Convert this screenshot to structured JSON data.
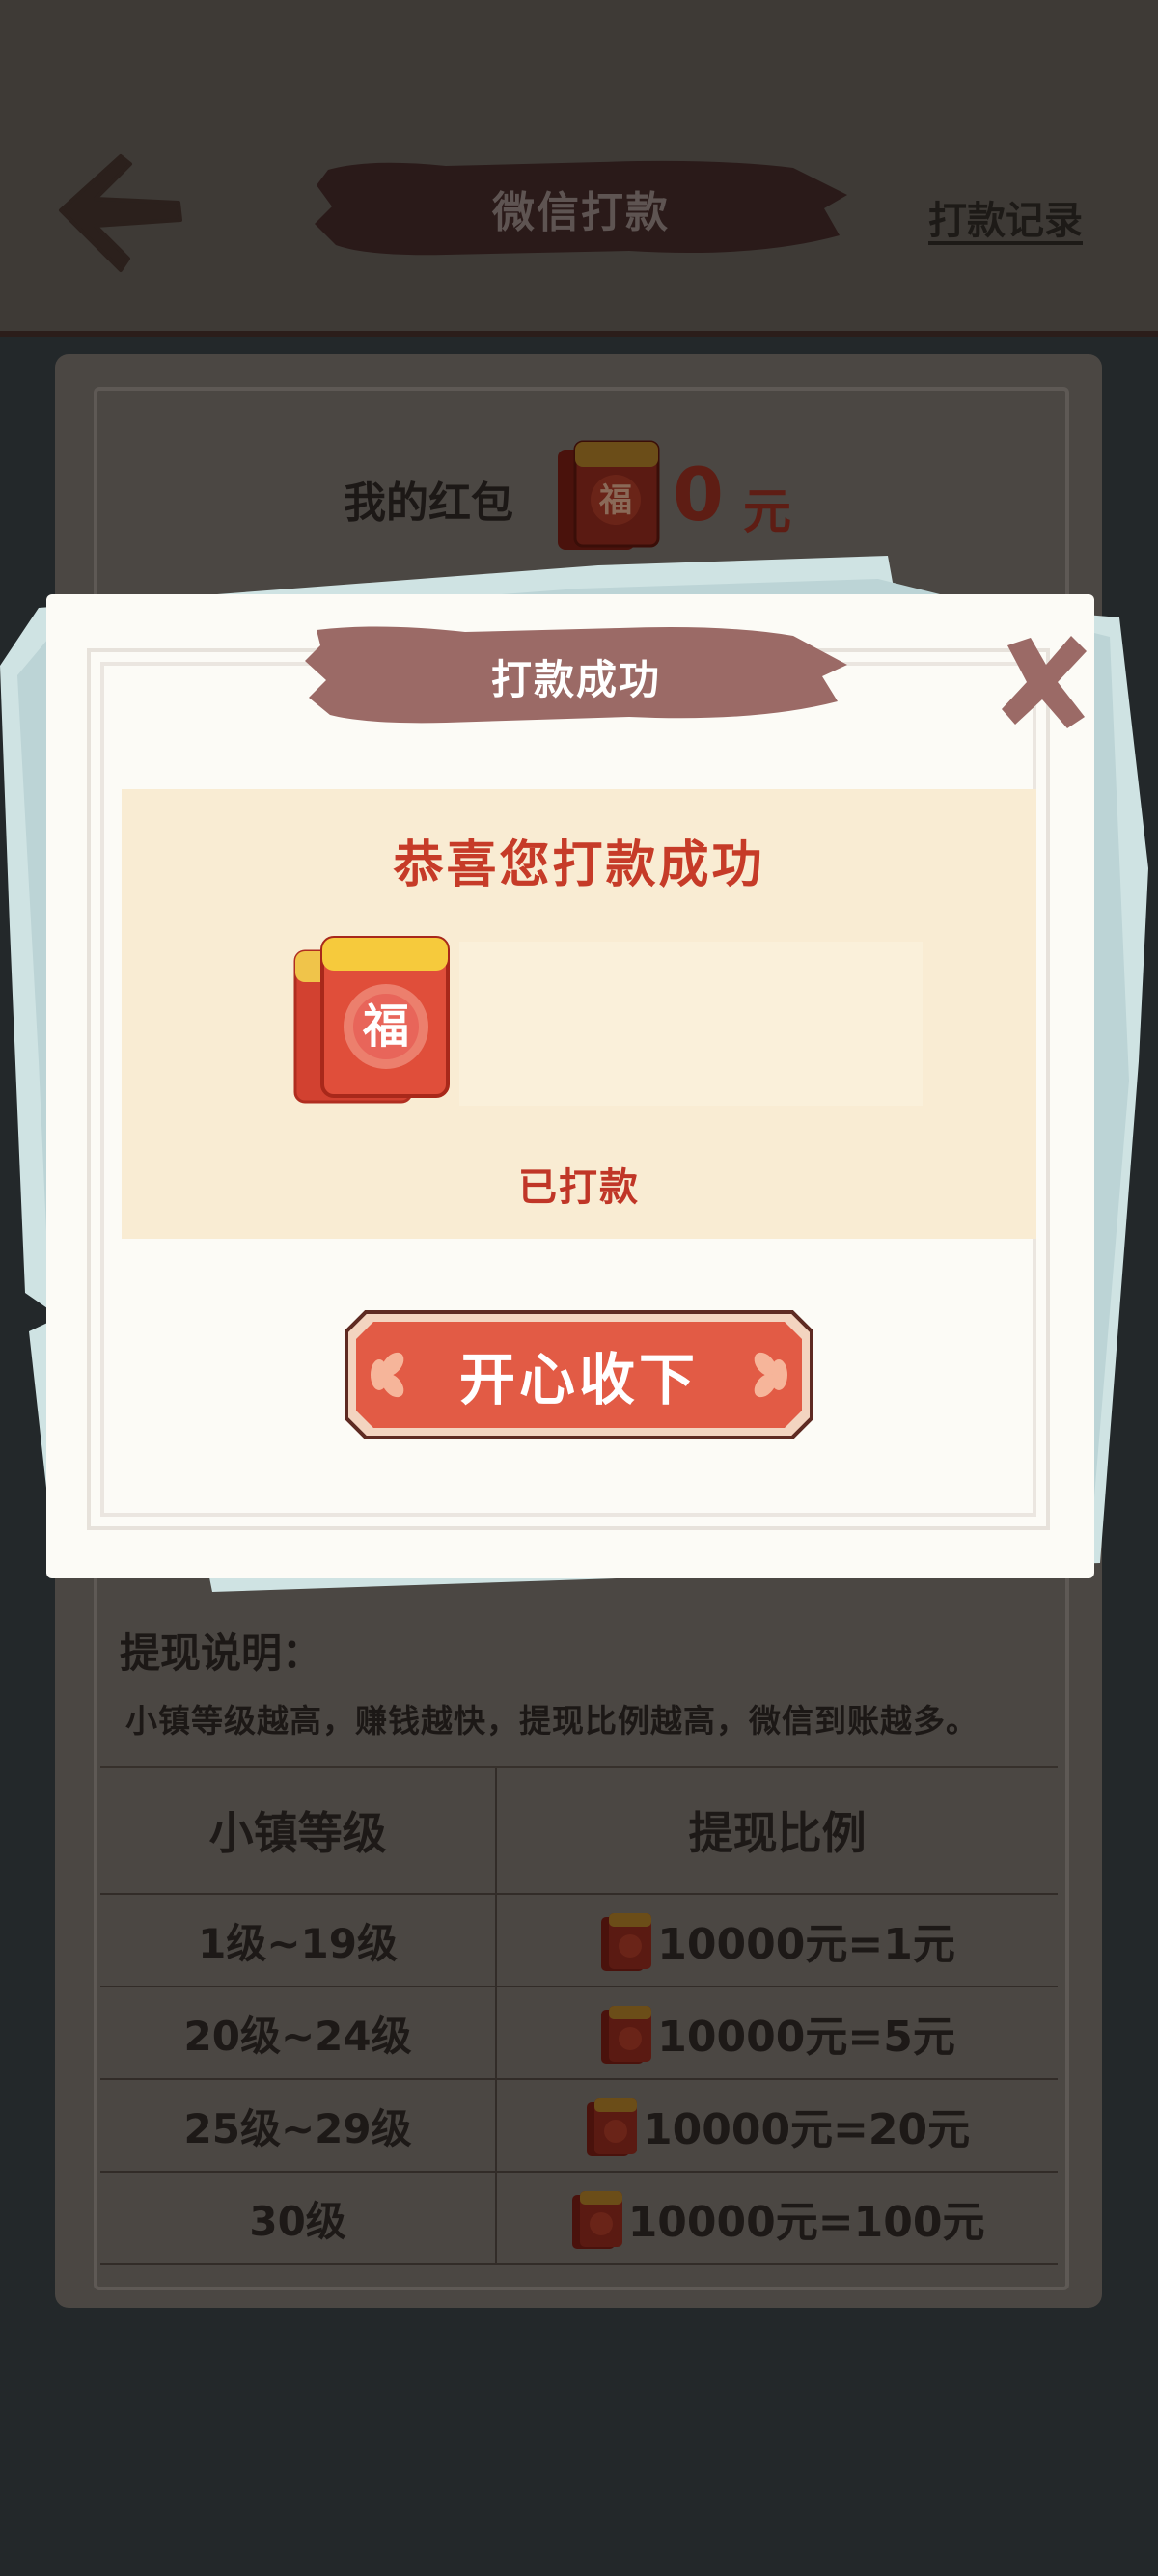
{
  "header": {
    "title": "微信打款",
    "record_link": "打款记录"
  },
  "wallet": {
    "label": "我的红包",
    "amount": "0",
    "unit": "元"
  },
  "notes": {
    "title": "提现说明：",
    "text": "小镇等级越高，赚钱越快，提现比例越高，微信到账越多。"
  },
  "table": {
    "headers": [
      "小镇等级",
      "提现比例"
    ],
    "rows": [
      {
        "level": "1级~19级",
        "rate": "10000元=1元"
      },
      {
        "level": "20级~24级",
        "rate": "10000元=5元"
      },
      {
        "level": "25级~29级",
        "rate": "10000元=20元"
      },
      {
        "level": "30级",
        "rate": "10000元=100元"
      }
    ]
  },
  "popup": {
    "title": "打款成功",
    "congrats": "恭喜您打款成功",
    "status": "已打款",
    "button": "开心收下"
  },
  "icons": {
    "fu_char": "福",
    "back": "arrow-left-icon",
    "close": "close-x-icon",
    "red_packet": "red-envelope-icon"
  },
  "colors": {
    "banner": "#9b6a66",
    "button": "#e25b45",
    "accent_red": "#c63b28"
  }
}
